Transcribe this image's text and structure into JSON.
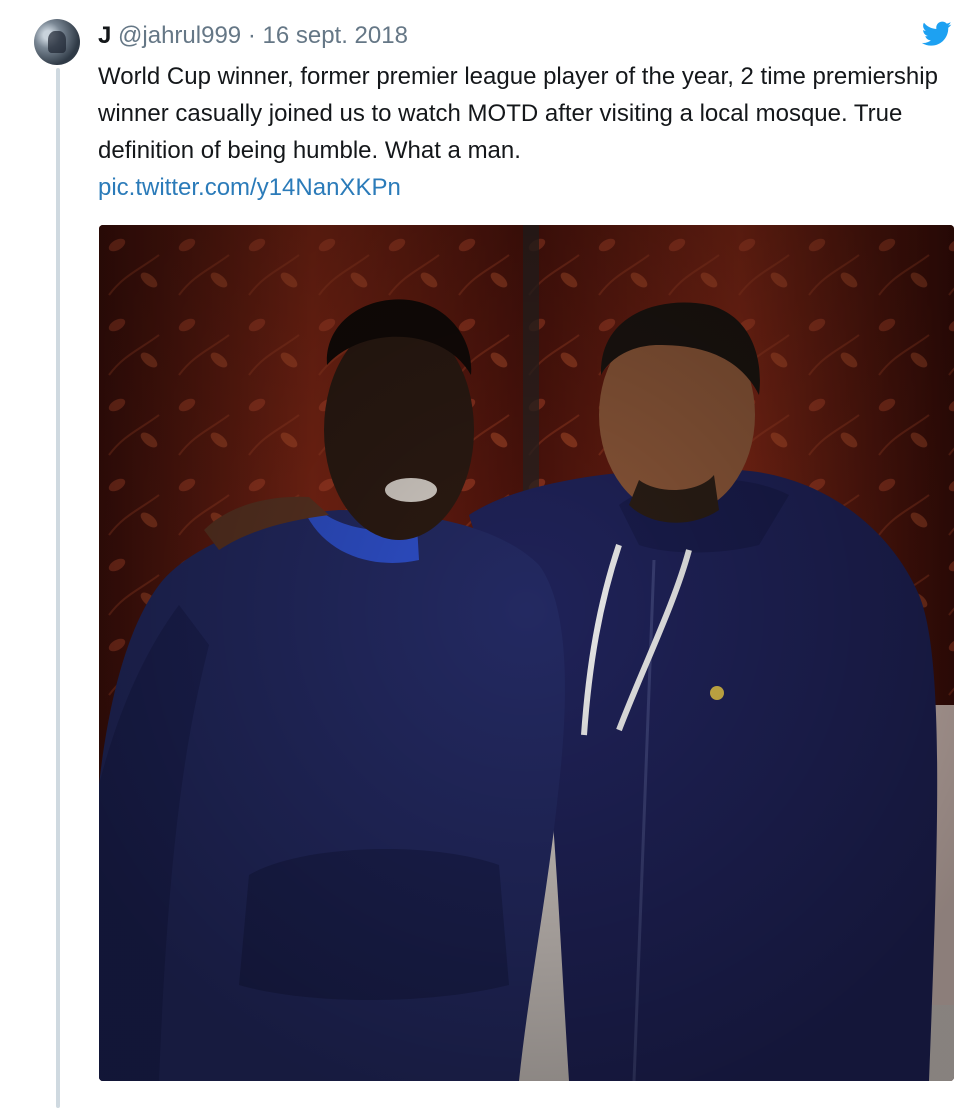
{
  "tweet": {
    "author_name": "J",
    "handle": "@jahrul999",
    "separator": "·",
    "date": "16 sept. 2018",
    "text": "World Cup winner, former premier league player of the year, 2 time premiership winner casually joined us to watch MOTD after visiting a local mosque. True definition of being humble. What a man.",
    "link": "pic.twitter.com/y14NanXKPn"
  },
  "icons": {
    "brand": "twitter-bird-icon",
    "avatar": "user-avatar"
  },
  "colors": {
    "brand_blue": "#1da1f2",
    "link_blue": "#2b7bb9",
    "secondary_text": "#657786",
    "thread_line": "#cfd9e0",
    "hoodie_navy": "#1d2257",
    "curtain_red": "#5a140c"
  }
}
